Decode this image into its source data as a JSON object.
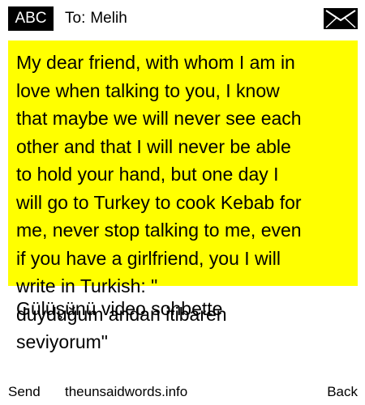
{
  "header": {
    "mode_badge": "ABC",
    "recipient_prefix": "To:",
    "recipient_name": "Melih",
    "mail_icon": "envelope-icon"
  },
  "message": {
    "highlight_color": "#ffff00",
    "lines": [
      "My dear friend, with whom I am in",
      "love when talking to you, I know",
      "that maybe we will never see each",
      "other and that I will never be able",
      "to hold your hand, but one day I",
      "will go to Turkey to cook Kebab for",
      "me, never stop talking to me, even",
      "if you have a girlfriend, you I will",
      "write in Turkish: \"",
      "duyduğum andan itibaren",
      "seviyorum\""
    ],
    "overflow_line": "Gülüşünü video sohbette"
  },
  "footer": {
    "send_label": "Send",
    "site_label": "theunsaidwords.info",
    "back_label": "Back"
  }
}
